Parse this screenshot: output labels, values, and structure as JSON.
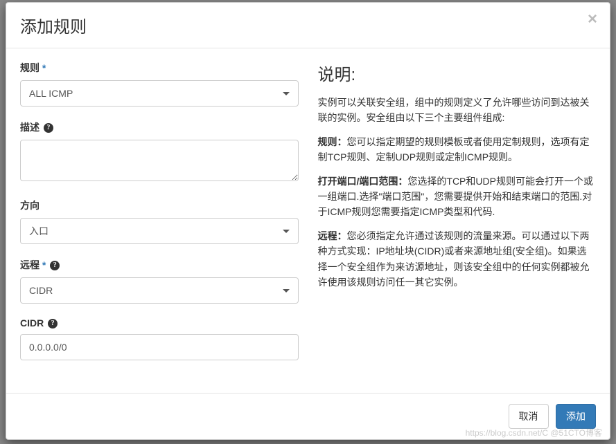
{
  "modal": {
    "title": "添加规则",
    "close": "×"
  },
  "form": {
    "rule": {
      "label": "规则",
      "value": "ALL ICMP"
    },
    "description": {
      "label": "描述",
      "value": ""
    },
    "direction": {
      "label": "方向",
      "value": "入口"
    },
    "remote": {
      "label": "远程",
      "value": "CIDR"
    },
    "cidr": {
      "label": "CIDR",
      "value": "0.0.0.0/0"
    }
  },
  "desc": {
    "title": "说明:",
    "intro": "实例可以关联安全组，组中的规则定义了允许哪些访问到达被关联的实例。安全组由以下三个主要组件组成:",
    "rule_bold": "规则：",
    "rule_text": "您可以指定期望的规则模板或者使用定制规则，选项有定制TCP规则、定制UDP规则或定制ICMP规则。",
    "port_bold": "打开端口/端口范围：",
    "port_text": "您选择的TCP和UDP规则可能会打开一个或一组端口.选择\"端口范围\"，您需要提供开始和结束端口的范围.对于ICMP规则您需要指定ICMP类型和代码.",
    "remote_bold": "远程：",
    "remote_text": "您必须指定允许通过该规则的流量来源。可以通过以下两种方式实现：IP地址块(CIDR)或者来源地址组(安全组)。如果选择一个安全组作为来访源地址，则该安全组中的任何实例都被允许使用该规则访问任一其它实例。"
  },
  "footer": {
    "cancel": "取消",
    "submit": "添加"
  },
  "watermark": "https://blog.csdn.net/C @51CTO博客"
}
